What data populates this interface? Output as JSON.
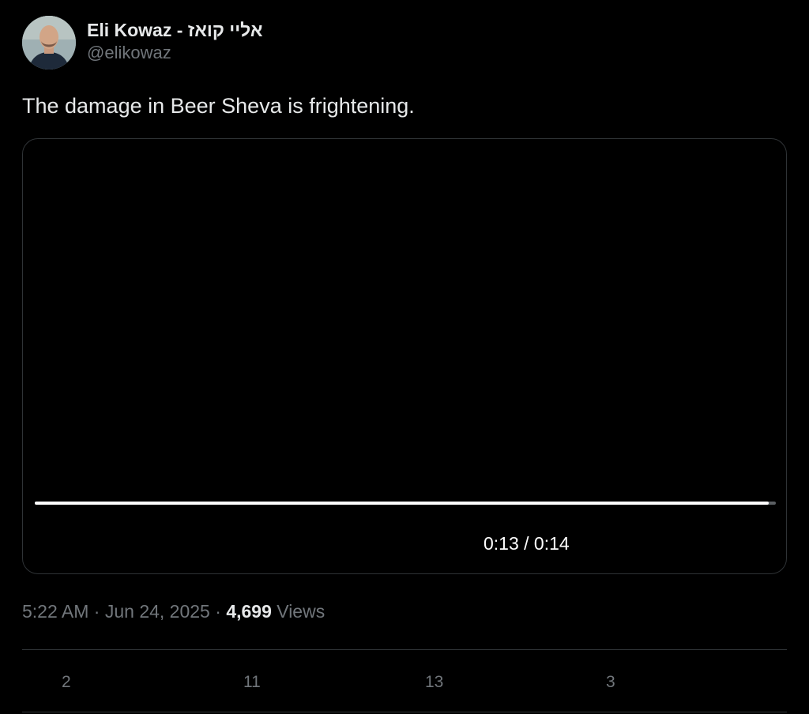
{
  "author": {
    "display_name": "Eli Kowaz - אליי קואז",
    "handle": "@elikowaz"
  },
  "tweet": {
    "text": "The damage in Beer Sheva is frightening."
  },
  "video": {
    "timecode": "0:13 / 0:14",
    "progress": 0.99
  },
  "meta": {
    "time": "5:22 AM",
    "separator": "·",
    "date": "Jun 24, 2025",
    "views_count": "4,699",
    "views_label": "Views"
  },
  "actions": {
    "replies": "2",
    "reposts": "11",
    "likes": "13",
    "bookmarks": "3"
  }
}
